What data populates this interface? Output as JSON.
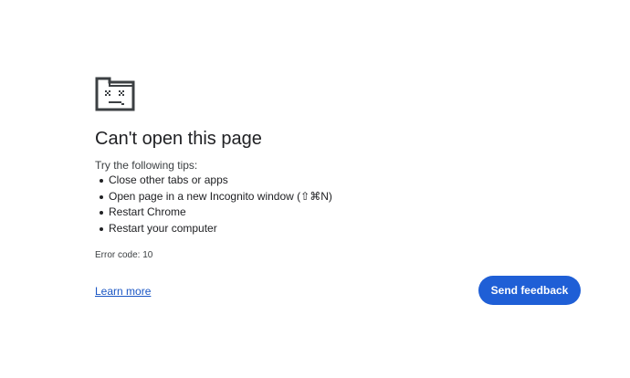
{
  "error": {
    "icon": "sad-folder-icon",
    "title": "Can't open this page",
    "tips_intro": "Try the following tips:",
    "tips": [
      "Close other tabs or apps",
      "Open page in a new Incognito window (⇧⌘N)",
      "Restart Chrome",
      "Restart your computer"
    ],
    "error_code": "Error code: 10"
  },
  "actions": {
    "learn_more": "Learn more",
    "send_feedback": "Send feedback"
  },
  "colors": {
    "link": "#1a56c4",
    "button_bg": "#1f5fd6",
    "button_text": "#ffffff",
    "title": "#202124"
  }
}
